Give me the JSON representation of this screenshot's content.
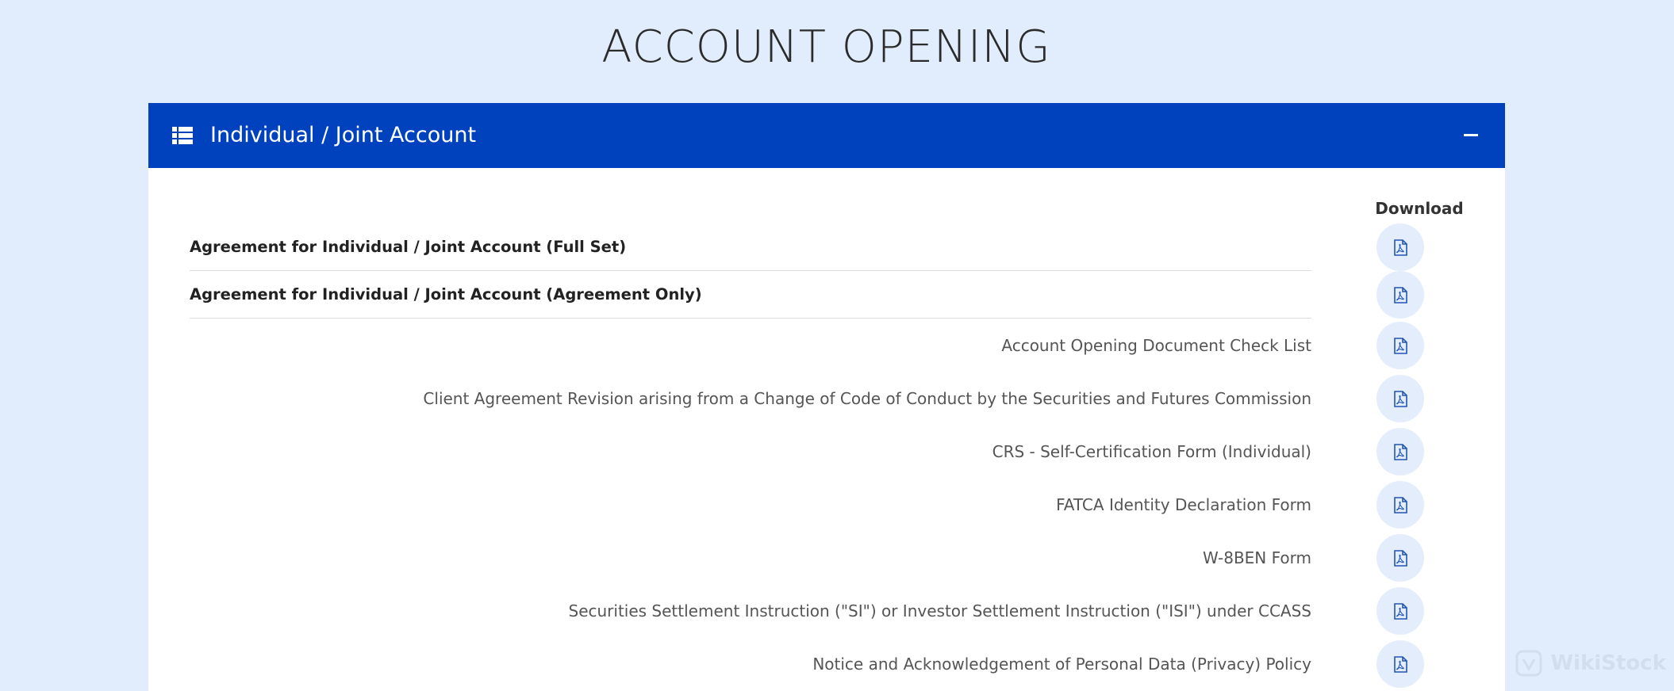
{
  "page": {
    "title": "ACCOUNT OPENING"
  },
  "panel": {
    "header_title": "Individual / Joint Account",
    "header_icon": "list-icon",
    "collapse_icon": "minus-icon",
    "download_label": "Download",
    "rows": [
      {
        "label": "Agreement for Individual / Joint Account (Full Set)",
        "style": "heading",
        "icon": "pdf-icon"
      },
      {
        "label": "Agreement for Individual / Joint Account (Agreement Only)",
        "style": "heading",
        "icon": "pdf-icon"
      },
      {
        "label": "Account Opening Document Check List",
        "style": "item",
        "icon": "pdf-icon"
      },
      {
        "label": "Client Agreement Revision arising from a Change of Code of Conduct by the Securities and Futures Commission",
        "style": "item",
        "icon": "pdf-icon"
      },
      {
        "label": "CRS - Self-Certification Form (Individual)",
        "style": "item",
        "icon": "pdf-icon"
      },
      {
        "label": "FATCA Identity Declaration Form",
        "style": "item",
        "icon": "pdf-icon"
      },
      {
        "label": "W-8BEN Form",
        "style": "item",
        "icon": "pdf-icon"
      },
      {
        "label": "Securities Settlement Instruction (\"SI\") or Investor Settlement Instruction (\"ISI\") under CCASS",
        "style": "item",
        "icon": "pdf-icon"
      },
      {
        "label": "Notice and Acknowledgement of Personal Data (Privacy) Policy",
        "style": "item",
        "icon": "pdf-icon"
      }
    ]
  },
  "watermark": {
    "text": "WikiStock"
  },
  "colors": {
    "background": "#e1edfc",
    "header": "#0042bd",
    "icon_blue": "#2255b5",
    "button_bg": "#e4edfb"
  }
}
